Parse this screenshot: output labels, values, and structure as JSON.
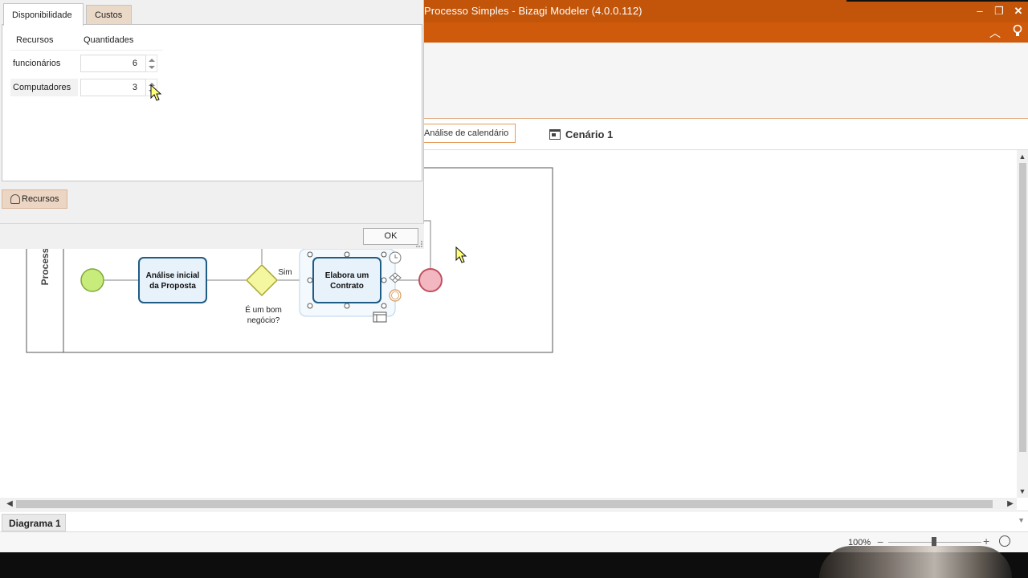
{
  "window": {
    "title": "Processo Simples - Bizagi Modeler (4.0.0.112)",
    "minimize": "–",
    "restore": "❐",
    "close": "✕"
  },
  "subbar": {
    "calendar_tab": "Análise de calendário",
    "scenario_tab": "Cenário 1"
  },
  "dialog": {
    "tabs": [
      "Disponibilidade",
      "Custos"
    ],
    "columns": {
      "resources": "Recursos",
      "quantities": "Quantidades"
    },
    "rows": [
      {
        "label": "funcionários",
        "value": "6"
      },
      {
        "label": "Computadores",
        "value": "3"
      }
    ],
    "resources_button": "Recursos",
    "ok_button": "OK"
  },
  "diagram": {
    "pool_label": "Process",
    "task1": [
      "Análise inicial",
      "da Proposta"
    ],
    "gateway_label": [
      "É um bom",
      "negócio?"
    ],
    "flow_label": "Sim",
    "task2": [
      "Elabora um",
      "Contrato"
    ]
  },
  "bottom": {
    "diagram_tab": "Diagrama 1",
    "zoom": "100%"
  },
  "colors": {
    "title_bar": "#c2550a",
    "ribbon": "#cf5a0c",
    "task_border": "#1f5c86",
    "task_fill": "#e8f2fb",
    "start_event": "#c8ec7c",
    "end_event": "#f2b7c0",
    "gateway": "#f5f6a0"
  }
}
